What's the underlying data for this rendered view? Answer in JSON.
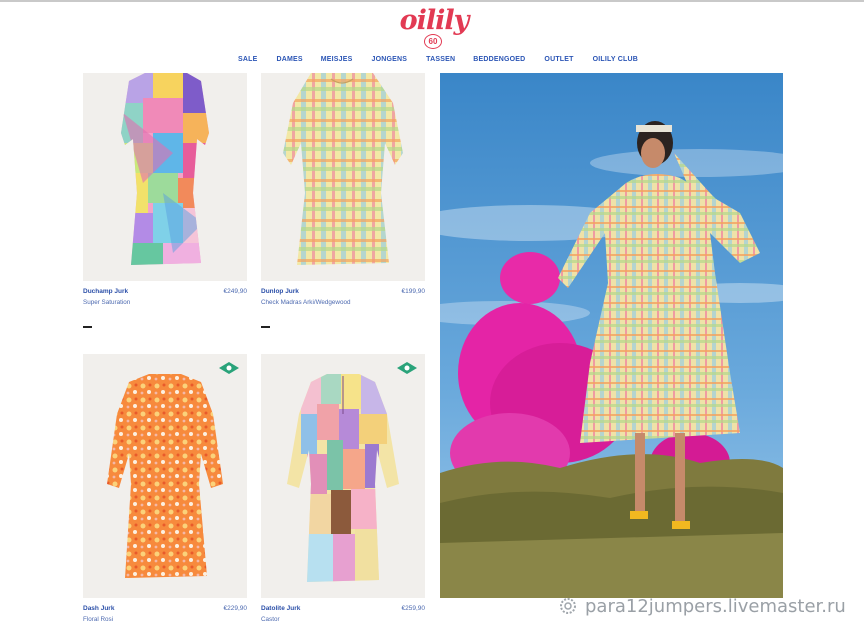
{
  "brand": {
    "logo_text": "oilily",
    "badge_text": "60",
    "color": "#e23a53"
  },
  "nav": {
    "items": [
      "SALE",
      "DAMES",
      "MEISJES",
      "JONGENS",
      "TASSEN",
      "BEDDENGOED",
      "OUTLET",
      "OILILY CLUB"
    ],
    "color": "#2b55b5"
  },
  "products": [
    {
      "name": "Duchamp Jurk",
      "price": "€249,90",
      "color": "Super Saturation"
    },
    {
      "name": "Dunlop Jurk",
      "price": "€199,90",
      "color": "Check Madras Arki/Wedgewood"
    },
    {
      "name": "Dash Jurk",
      "price": "€229,90",
      "color": "Floral Rosi"
    },
    {
      "name": "Datolite Jurk",
      "price": "€259,90",
      "color": "Castor"
    }
  ],
  "watermark": {
    "text": "para12jumpers.livemaster.ru"
  }
}
